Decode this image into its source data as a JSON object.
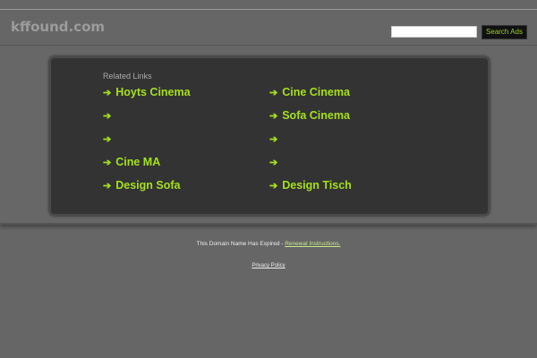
{
  "header": {
    "site_name": "kffound.com",
    "search_value": "",
    "search_button": "Search Ads"
  },
  "related": {
    "title": "Related Links",
    "arrow": "➔",
    "links": [
      {
        "label": "Hoyts Cinema"
      },
      {
        "label": "Cine Cinema"
      },
      {
        "label": ""
      },
      {
        "label": "Sofa Cinema"
      },
      {
        "label": ""
      },
      {
        "label": ""
      },
      {
        "label": "Cine MA"
      },
      {
        "label": ""
      },
      {
        "label": "Design Sofa"
      },
      {
        "label": "Design Tisch"
      }
    ]
  },
  "footer": {
    "expired_text": "This Domain Name Has Expired - ",
    "renewal_link": "Renewal Instructions.",
    "privacy_link": "Privacy Policy"
  },
  "colors": {
    "accent": "#a4e01e",
    "background": "#666666",
    "panel": "#333333"
  }
}
